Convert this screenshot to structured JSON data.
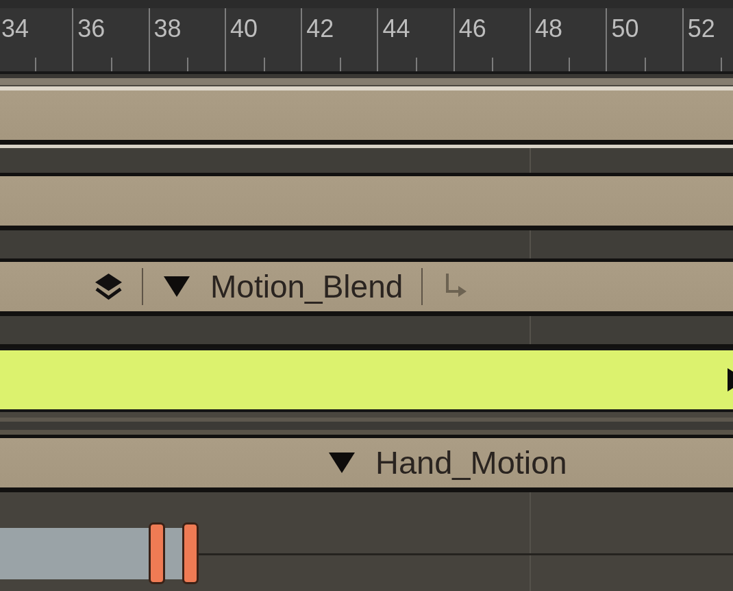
{
  "ruler": {
    "labels": [
      "34",
      "36",
      "38",
      "40",
      "42",
      "44",
      "46",
      "48",
      "50",
      "52"
    ]
  },
  "tracks": [
    {
      "kind": "group"
    },
    {
      "kind": "group"
    },
    {
      "kind": "layer",
      "label": "Motion_Blend",
      "expanded": true
    },
    {
      "kind": "clip"
    },
    {
      "kind": "group",
      "label": "Hand_Motion",
      "expanded": true
    },
    {
      "kind": "keys"
    }
  ]
}
